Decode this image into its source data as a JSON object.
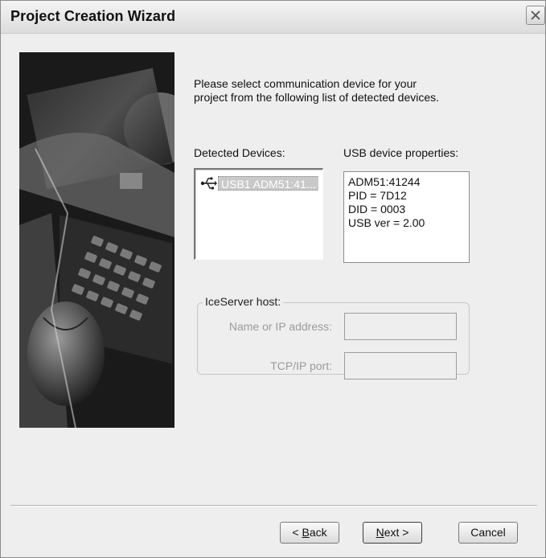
{
  "window": {
    "title": "Project Creation Wizard"
  },
  "icons": {
    "close": "close-x-icon",
    "usb": "usb-trident-icon",
    "side_image": "laptop-and-mouse-illustration"
  },
  "content": {
    "intro_line1": "Please select communication device for your",
    "intro_line2": "project from the following list of detected devices."
  },
  "detected_devices": {
    "label": "Detected Devices:",
    "items": [
      {
        "label": "USB1 ADM51:41...",
        "selected": true
      }
    ]
  },
  "usb_properties": {
    "label": "USB device properties:",
    "lines": [
      "ADM51:41244",
      "PID = 7D12",
      "DID = 0003",
      "USB ver = 2.00"
    ]
  },
  "iceserver": {
    "legend": "IceServer host:",
    "name_label": "Name or IP address:",
    "name_value": "",
    "port_label": "TCP/IP port:",
    "port_value": "",
    "enabled": false
  },
  "buttons": {
    "back_prefix": "< ",
    "back_mnemonic": "B",
    "back_rest": "ack",
    "next_mnemonic": "N",
    "next_rest": "ext >",
    "cancel": "Cancel"
  },
  "colors": {
    "selection_bg": "#c9c9c9",
    "disabled_text": "#9b9b9b"
  }
}
